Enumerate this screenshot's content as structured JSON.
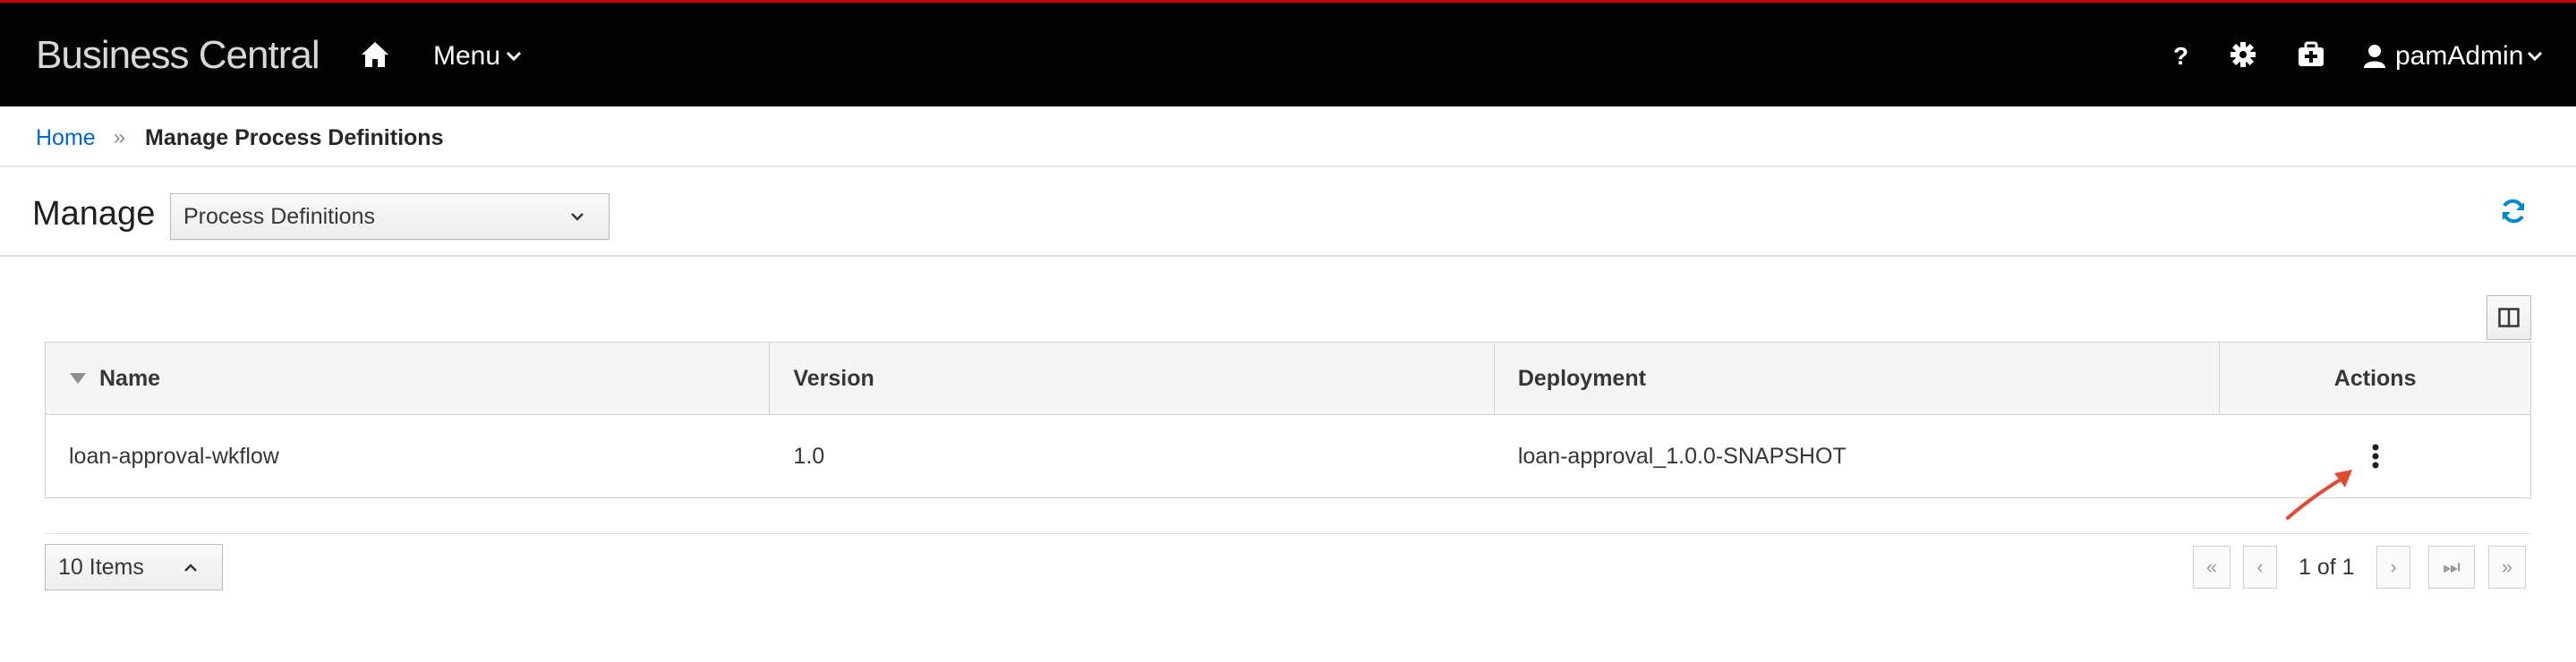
{
  "app": {
    "title": "Business Central"
  },
  "topnav": {
    "menu_label": "Menu",
    "help_label": "?",
    "user_label": "pamAdmin"
  },
  "breadcrumb": {
    "home": "Home",
    "separator": "»",
    "current": "Manage Process Definitions"
  },
  "toolbar": {
    "manage_label": "Manage",
    "selected_view": "Process Definitions"
  },
  "table": {
    "columns": [
      "Name",
      "Version",
      "Deployment",
      "Actions"
    ],
    "rows": [
      {
        "name": "loan-approval-wkflow",
        "version": "1.0",
        "deployment": "loan-approval_1.0.0-SNAPSHOT"
      }
    ]
  },
  "pagination": {
    "page_size": "10 Items",
    "page_label": "1 of 1"
  },
  "colors": {
    "accent": "#0066cc",
    "topnav_bg": "#030303",
    "topnav_border": "#cc0000",
    "arrow": "#e24a32"
  },
  "icons": [
    "home-icon",
    "chevron-down-icon",
    "help-icon",
    "gear-icon",
    "briefcase-icon",
    "user-icon",
    "refresh-icon",
    "columns-icon",
    "sort-down-icon",
    "kebab-icon",
    "arrow-annotation-icon"
  ]
}
